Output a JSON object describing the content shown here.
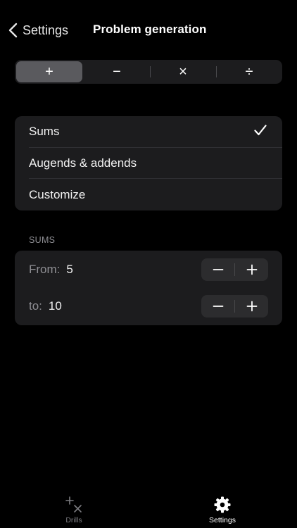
{
  "nav": {
    "back_label": "Settings",
    "title": "Problem generation"
  },
  "operations": {
    "selected": 0,
    "items": [
      {
        "symbol": "+",
        "name": "plus-segment"
      },
      {
        "symbol": "−",
        "name": "minus-segment"
      },
      {
        "symbol": "×",
        "name": "times-segment"
      },
      {
        "symbol": "÷",
        "name": "divide-segment"
      }
    ]
  },
  "generation_modes": {
    "selected": 0,
    "check_icon": "checkmark-icon",
    "items": [
      {
        "label": "Sums"
      },
      {
        "label": "Augends & addends"
      },
      {
        "label": "Customize"
      }
    ]
  },
  "sums": {
    "header": "SUMS",
    "from": {
      "label": "From:",
      "value": "5"
    },
    "to": {
      "label": "to:",
      "value": "10"
    }
  },
  "tabbar": {
    "tabs": [
      {
        "label": "Drills",
        "icon": "drills-icon",
        "selected": false
      },
      {
        "label": "Settings",
        "icon": "gear-icon",
        "selected": true
      }
    ]
  },
  "colors": {
    "background": "#000000",
    "card": "#1c1c1e",
    "selected_segment": "#5a5a5e",
    "secondary_text": "#8e8e93"
  }
}
